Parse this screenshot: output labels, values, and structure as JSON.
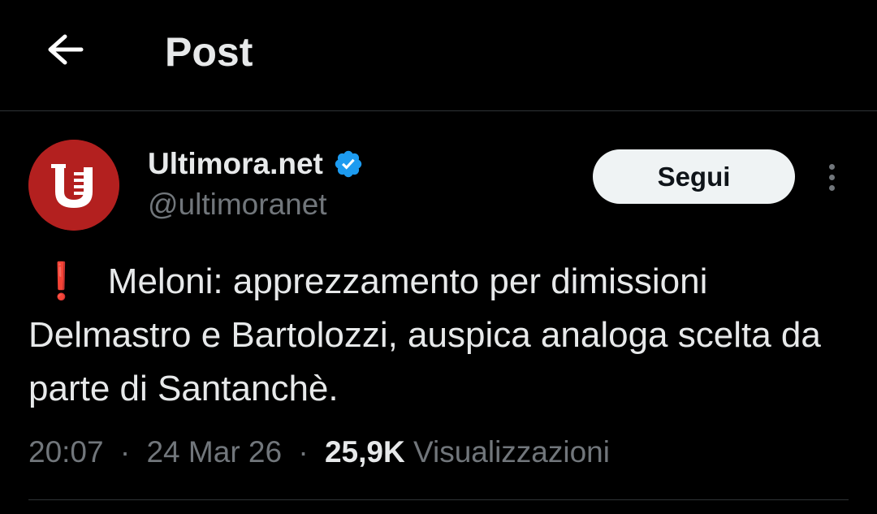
{
  "header": {
    "title": "Post",
    "back_icon": "arrow-left-icon"
  },
  "author": {
    "name": "Ultimora.net",
    "handle": "@ultimoranet",
    "verified": true,
    "verified_icon": "verified-badge-icon",
    "avatar_icon": "ultimora-logo",
    "avatar_letter": "U",
    "avatar_color": "#b3201f"
  },
  "actions": {
    "follow_label": "Segui",
    "more_icon": "more-vertical-icon"
  },
  "post": {
    "emoji": "❗",
    "text": "Meloni: apprezzamento per dimissioni Delmastro e Bartolozzi, auspica analoga scelta da parte di Santanchè."
  },
  "meta": {
    "time": "20:07",
    "separator": "·",
    "date": "24 Mar 26",
    "views_count": "25,9K",
    "views_label": "Visualizzazioni"
  },
  "colors": {
    "background": "#000000",
    "text": "#e7e9ea",
    "secondary_text": "#71767b",
    "verified_blue": "#1d9bf0",
    "divider": "#2f3336",
    "alert_red": "#e0303a"
  }
}
